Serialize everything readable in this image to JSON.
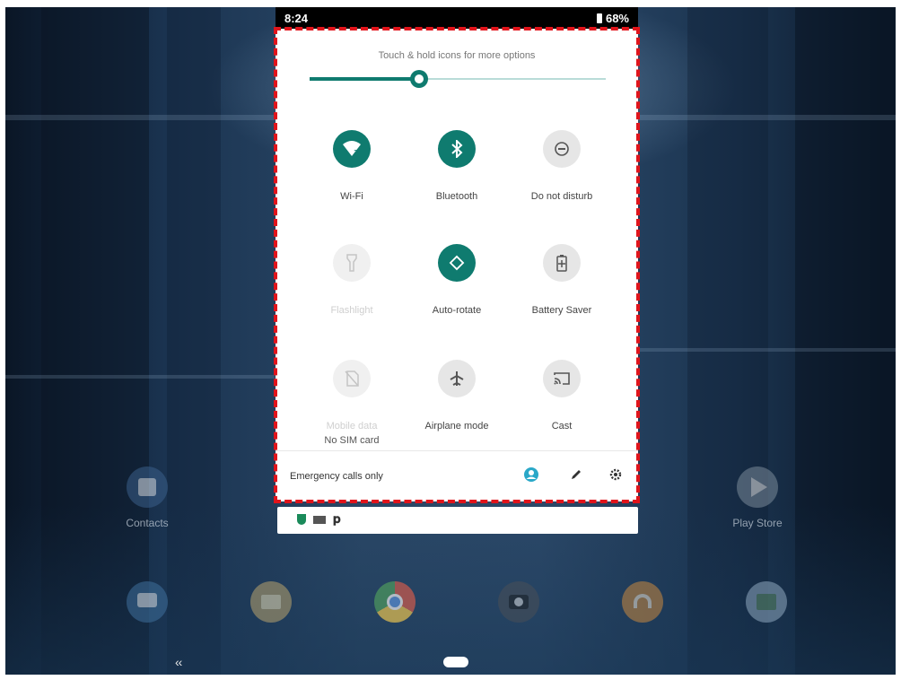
{
  "status_bar": {
    "time": "8:24",
    "battery": "68%"
  },
  "quick_settings": {
    "hint": "Touch & hold icons for more options",
    "brightness_level": 0.37,
    "tiles": [
      {
        "id": "wifi",
        "label": "Wi-Fi",
        "state": "on",
        "icon": "wifi-question-icon"
      },
      {
        "id": "bluetooth",
        "label": "Bluetooth",
        "state": "on",
        "icon": "bluetooth-icon"
      },
      {
        "id": "dnd",
        "label": "Do not disturb",
        "state": "off",
        "icon": "do-not-disturb-icon"
      },
      {
        "id": "flashlight",
        "label": "Flashlight",
        "state": "disabled",
        "icon": "flashlight-icon"
      },
      {
        "id": "autorotate",
        "label": "Auto-rotate",
        "state": "on",
        "icon": "auto-rotate-icon"
      },
      {
        "id": "battery_saver",
        "label": "Battery Saver",
        "state": "off",
        "icon": "battery-saver-icon"
      },
      {
        "id": "mobile_data",
        "label": "Mobile data",
        "sublabel": "No SIM card",
        "state": "disabled",
        "icon": "no-sim-icon"
      },
      {
        "id": "airplane",
        "label": "Airplane mode",
        "state": "off",
        "icon": "airplane-icon"
      },
      {
        "id": "cast",
        "label": "Cast",
        "state": "off",
        "icon": "cast-icon"
      }
    ],
    "footer": {
      "status": "Emergency calls only"
    }
  },
  "home": {
    "apps": [
      {
        "label": "Contacts",
        "icon": "contacts-icon"
      },
      {
        "label": "Play Store",
        "icon": "play-store-icon"
      },
      {
        "label": "",
        "icon": "messages-icon"
      },
      {
        "label": "",
        "icon": "email-icon"
      },
      {
        "label": "",
        "icon": "chrome-icon"
      },
      {
        "label": "",
        "icon": "camera-icon"
      },
      {
        "label": "",
        "icon": "music-icon"
      },
      {
        "label": "",
        "icon": "gallery-icon"
      }
    ]
  },
  "colors": {
    "accent": "#0f7b6f",
    "highlight": "#e1141b"
  }
}
